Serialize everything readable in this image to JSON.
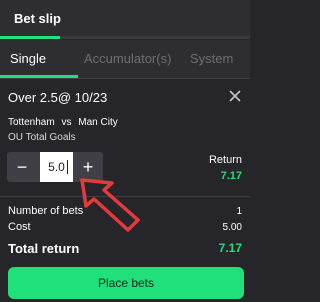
{
  "header": {
    "title": "Bet slip"
  },
  "tabs": [
    {
      "label": "Single",
      "active": true
    },
    {
      "label": "Accumulator(s)",
      "active": false
    },
    {
      "label": "System",
      "active": false
    }
  ],
  "selection": {
    "title": "Over 2.5@ 10/23",
    "home": "Tottenham",
    "vs": "vs",
    "away": "Man City",
    "market": "OU Total Goals"
  },
  "stake": {
    "minus_label": "−",
    "plus_label": "+",
    "value": "5.0"
  },
  "return": {
    "label": "Return",
    "value": "7.17"
  },
  "summary": {
    "num_bets_label": "Number of bets",
    "num_bets_value": "1",
    "cost_label": "Cost",
    "cost_value": "5.00",
    "total_label": "Total return",
    "total_value": "7.17"
  },
  "actions": {
    "place_label": "Place bets"
  },
  "colors": {
    "accent": "#1fe07a",
    "background": "#26262a",
    "arrow": "#e23b3b"
  },
  "icons": {
    "close": "close-icon",
    "arrow": "annotation-arrow"
  }
}
